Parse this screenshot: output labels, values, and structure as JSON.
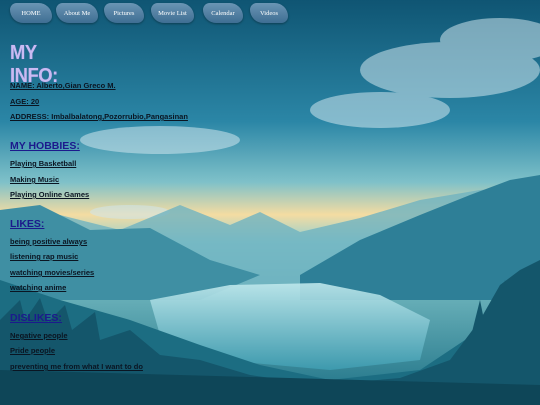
{
  "nav": {
    "items": [
      "HOME",
      "About Me",
      "Pictures",
      "Movie List",
      "Calendar",
      "Videos"
    ]
  },
  "info": {
    "title": "MY INFO:",
    "name": "NAME: Alberto,Gian Greco M.",
    "age": "AGE: 20",
    "address": "ADDRESS: Imbalbalatong,Pozorrubio,Pangasinan"
  },
  "hobbies": {
    "heading": "MY HOBBIES:",
    "items": [
      "Playing Basketball",
      "Making Music",
      "Playing Online Games"
    ]
  },
  "likes": {
    "heading": "LIKES:",
    "items": [
      "being positive always",
      "listening rap music",
      "watching movies/series",
      "watching anime"
    ]
  },
  "dislikes": {
    "heading": "DISLIKES:",
    "items": [
      "Negative people",
      "Pride people",
      "preventing me from what I want to do"
    ]
  },
  "colors": {
    "title": "#c9bbf2",
    "section_heading": "#1c1a8c",
    "nav_button": "#4f7fa3"
  }
}
